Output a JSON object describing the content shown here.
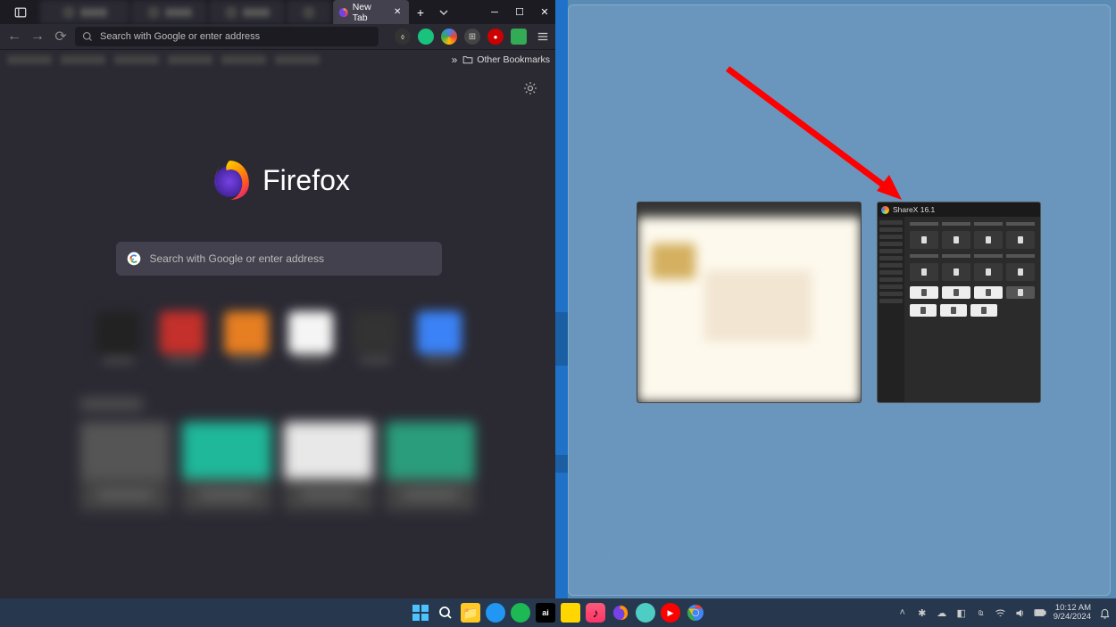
{
  "firefox": {
    "tabs": {
      "active_title": "New Tab"
    },
    "urlbar": {
      "placeholder": "Search with Google or enter address"
    },
    "bookmarks": {
      "other": "Other Bookmarks"
    },
    "logo_text": "Firefox",
    "search": {
      "placeholder": "Search with Google or enter address"
    }
  },
  "snap": {
    "sharex_title": "ShareX 16.1"
  },
  "taskbar": {
    "time": "10:12 AM",
    "date": "9/24/2024"
  },
  "colors": {
    "firefox_bg": "#1c1b22",
    "snap_bg": "#5a8bb5",
    "arrow": "#ff0000"
  }
}
